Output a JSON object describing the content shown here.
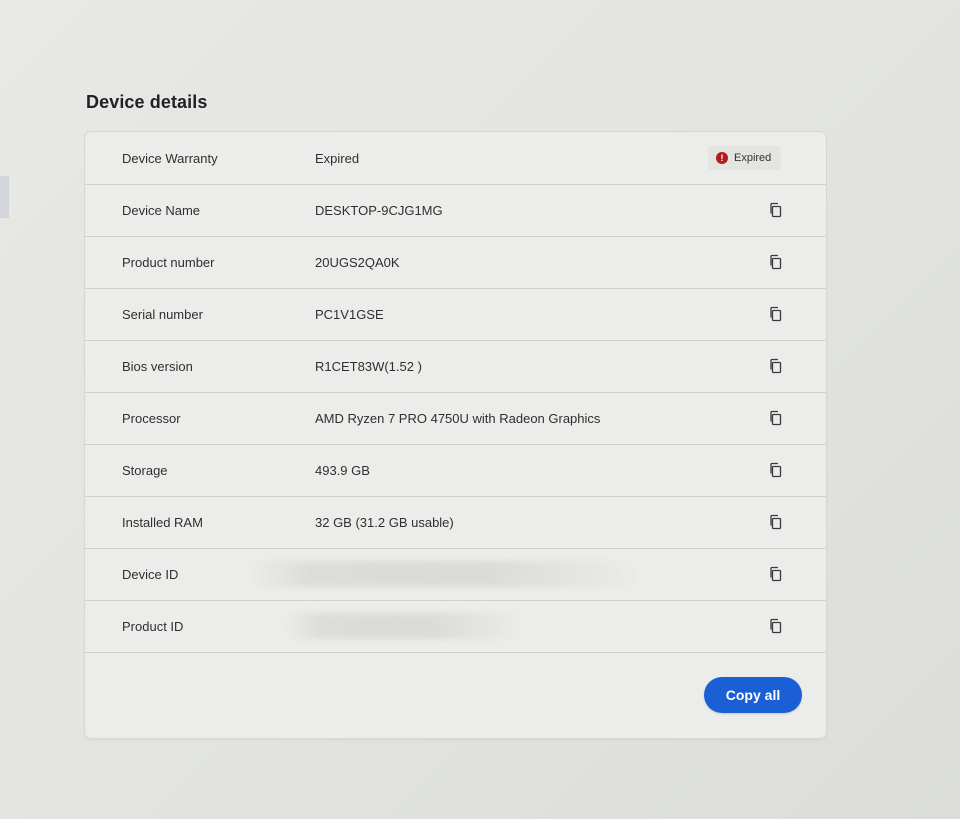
{
  "section": {
    "title": "Device details"
  },
  "rows": [
    {
      "label": "Device Warranty",
      "value": "Expired",
      "badge": "Expired"
    },
    {
      "label": "Device Name",
      "value": "DESKTOP-9CJG1MG"
    },
    {
      "label": "Product number",
      "value": "20UGS2QA0K"
    },
    {
      "label": "Serial number",
      "value": "PC1V1GSE"
    },
    {
      "label": "Bios version",
      "value": "R1CET83W(1.52 )"
    },
    {
      "label": "Processor",
      "value": "AMD Ryzen 7 PRO 4750U with Radeon Graphics"
    },
    {
      "label": "Storage",
      "value": "493.9 GB"
    },
    {
      "label": "Installed RAM",
      "value": "32 GB (31.2 GB usable)"
    },
    {
      "label": "Device ID",
      "value": ""
    },
    {
      "label": "Product ID",
      "value": ""
    }
  ],
  "footer": {
    "copy_all_label": "Copy all"
  },
  "icons": {
    "copy": "copy-icon",
    "error": "error-icon"
  },
  "colors": {
    "accent": "#1a5fd6",
    "error": "#b31b1b"
  }
}
